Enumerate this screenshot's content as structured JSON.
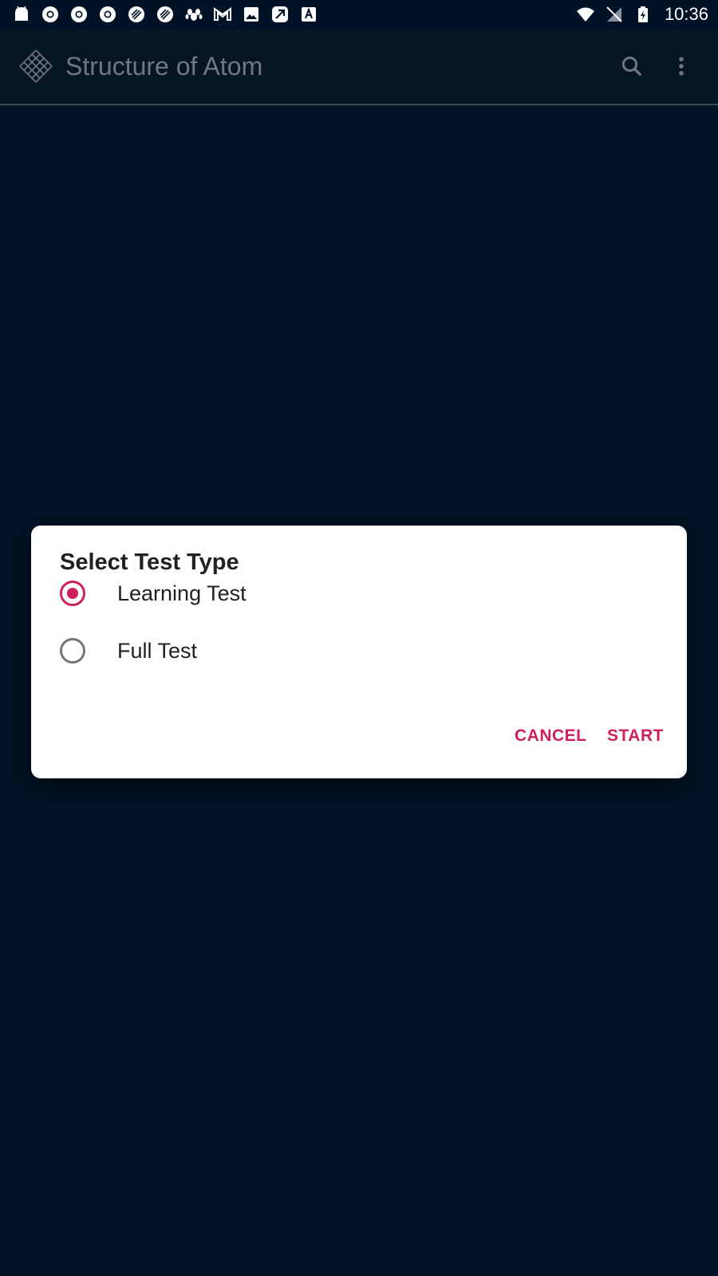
{
  "status_bar": {
    "time": "10:36",
    "left_icons": [
      "android-icon",
      "chrome-icon",
      "chrome-icon",
      "chrome-icon",
      "app-icon",
      "app-icon",
      "paw-icon",
      "gmail-icon",
      "image-icon",
      "app-icon",
      "text-a-icon"
    ],
    "right_icons": [
      "wifi-icon",
      "no-signal-icon",
      "battery-charging-icon"
    ]
  },
  "app_bar": {
    "title": "Structure of Atom",
    "search_icon": "search-icon",
    "menu_icon": "more-vert-icon"
  },
  "dialog": {
    "title": "Select Test Type",
    "options": [
      {
        "label": "Learning Test",
        "selected": true
      },
      {
        "label": "Full Test",
        "selected": false
      }
    ],
    "cancel_label": "CANCEL",
    "start_label": "START"
  },
  "colors": {
    "accent": "#cf1f5e",
    "background": "#021425",
    "app_bar": "#061523",
    "dialog": "#ffffff"
  }
}
